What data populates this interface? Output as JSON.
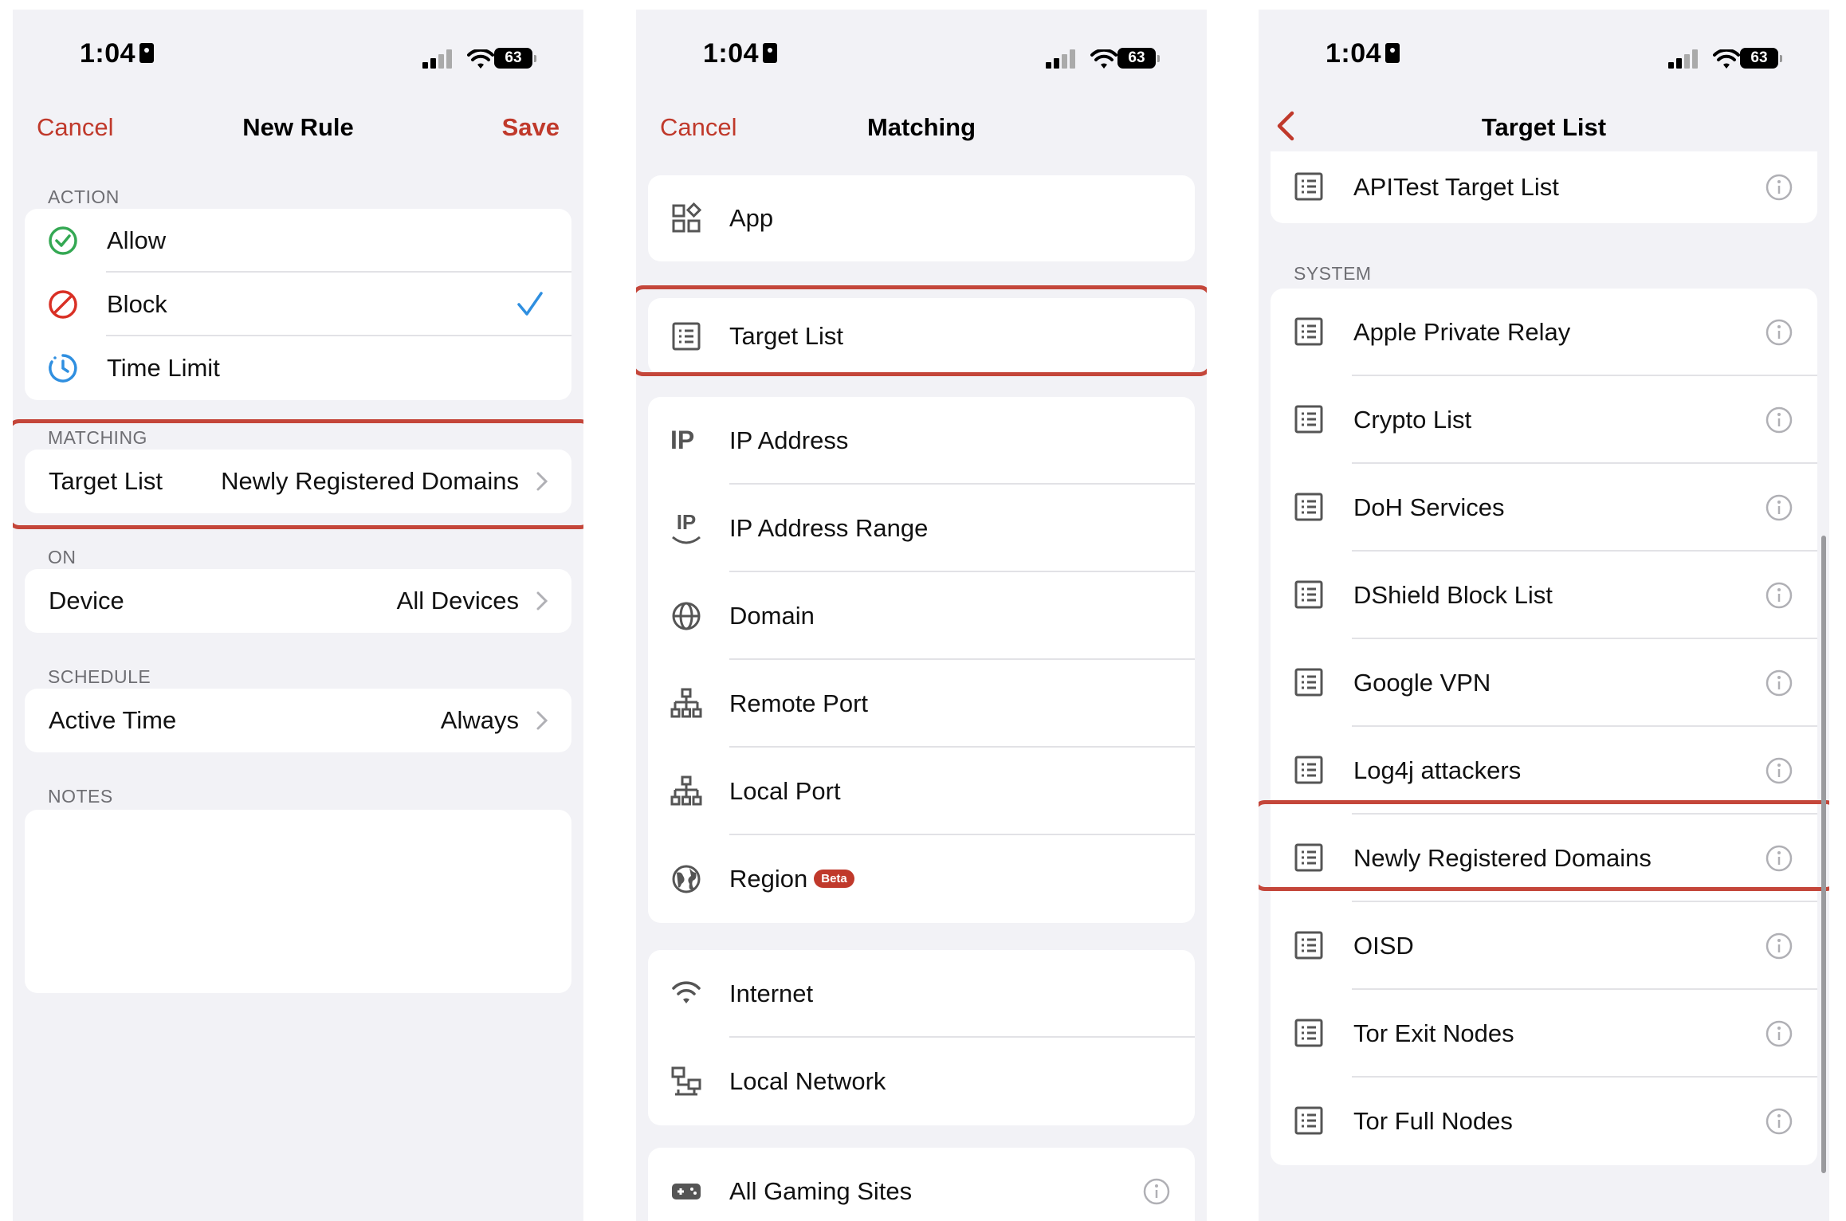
{
  "status": {
    "time": "1:04",
    "battery": "63"
  },
  "screen1": {
    "nav": {
      "cancel": "Cancel",
      "title": "New Rule",
      "save": "Save"
    },
    "action_header": "ACTION",
    "actions": [
      {
        "label": "Allow",
        "icon": "check-circle-icon"
      },
      {
        "label": "Block",
        "icon": "block-icon",
        "selected": true
      },
      {
        "label": "Time Limit",
        "icon": "clock-icon"
      }
    ],
    "matching_header": "MATCHING",
    "matching": {
      "label": "Target List",
      "value": "Newly Registered Domains"
    },
    "on_header": "ON",
    "device": {
      "label": "Device",
      "value": "All Devices"
    },
    "schedule_header": "SCHEDULE",
    "schedule": {
      "label": "Active Time",
      "value": "Always"
    },
    "notes_header": "NOTES"
  },
  "screen2": {
    "nav": {
      "cancel": "Cancel",
      "title": "Matching"
    },
    "items": [
      {
        "label": "App",
        "icon": "apps-icon"
      },
      {
        "label": "Target List",
        "icon": "list-icon"
      },
      {
        "label": "IP Address",
        "icon": "ip-icon",
        "icon_text": "IP"
      },
      {
        "label": "IP Address Range",
        "icon": "ip-range-icon",
        "icon_text": "IP"
      },
      {
        "label": "Domain",
        "icon": "globe-icon"
      },
      {
        "label": "Remote Port",
        "icon": "network-icon"
      },
      {
        "label": "Local Port",
        "icon": "network-icon"
      },
      {
        "label": "Region",
        "icon": "earth-icon",
        "badge": "Beta"
      },
      {
        "label": "Internet",
        "icon": "wifi-icon"
      },
      {
        "label": "Local Network",
        "icon": "local-network-icon"
      },
      {
        "label": "All Gaming Sites",
        "icon": "gamepad-icon"
      }
    ]
  },
  "screen3": {
    "nav": {
      "title": "Target List"
    },
    "top_item": "APITest Target List",
    "system_header": "SYSTEM",
    "system_items": [
      "Apple Private Relay",
      "Crypto List",
      "DoH Services",
      "DShield Block List",
      "Google VPN",
      "Log4j attackers",
      "Newly Registered Domains",
      "OISD",
      "Tor Exit Nodes",
      "Tor Full Nodes"
    ]
  },
  "colors": {
    "accent": "#c0392b",
    "highlight": "#c4463a",
    "allow": "#34a853",
    "block": "#d93025",
    "time": "#2f8fe0",
    "check": "#2f8fe0"
  }
}
